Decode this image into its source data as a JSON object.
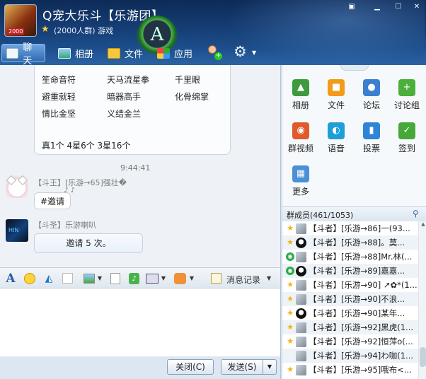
{
  "window": {
    "group_name": "Q宠大乐斗【乐游团】",
    "group_sub": "(2000人群) 游戏",
    "avatar_tag": "2000",
    "logo_glyph": "A"
  },
  "toolbar": {
    "tabs": [
      {
        "label": "聊天",
        "icon": "chat-icon",
        "active": true
      },
      {
        "label": "相册",
        "icon": "album-icon"
      },
      {
        "label": "文件",
        "icon": "folder-icon"
      },
      {
        "label": "应用",
        "icon": "apps-icon"
      }
    ]
  },
  "chat": {
    "skills": [
      [
        "笙命音符",
        "天马流星拳",
        "千里眼"
      ],
      [
        "避重就轻",
        "暗器高手",
        "化骨绵掌"
      ],
      [
        "情比金坚",
        "义结金兰",
        ""
      ]
    ],
    "skill_summary": "真1个 4星6个 3星16个",
    "timestamp": "9:44:41",
    "messages": [
      {
        "sender": "【斗王】[乐游→65]强壮�",
        "text": "#邀请",
        "deco": "♪ ♪"
      },
      {
        "sender": "【斗圣】乐游喇叭",
        "text": "邀请 5 次。"
      }
    ]
  },
  "input_toolbar": {
    "history_label": "消息记录"
  },
  "buttons": {
    "close": "关闭(C)",
    "send": "发送(S)"
  },
  "apps": [
    {
      "label": "相册",
      "icon": "album-app-icon",
      "color": "#3d9a3d",
      "glyph": "▲"
    },
    {
      "label": "文件",
      "icon": "file-app-icon",
      "color": "#f29b1a",
      "glyph": "■"
    },
    {
      "label": "论坛",
      "icon": "forum-app-icon",
      "color": "#3a7fd0",
      "glyph": "●"
    },
    {
      "label": "讨论组",
      "icon": "discussion-app-icon",
      "color": "#4caf3b",
      "glyph": "+"
    },
    {
      "label": "群视频",
      "icon": "video-app-icon",
      "color": "#e05a2a",
      "glyph": "◉"
    },
    {
      "label": "语音",
      "icon": "voice-app-icon",
      "color": "#1f9fd8",
      "glyph": "◐"
    },
    {
      "label": "投票",
      "icon": "vote-app-icon",
      "color": "#2f84d6",
      "glyph": "▮"
    },
    {
      "label": "签到",
      "icon": "checkin-app-icon",
      "color": "#47a83a",
      "glyph": "✓"
    },
    {
      "label": "更多",
      "icon": "more-app-icon",
      "color": "#4b8fd6",
      "glyph": "▦"
    }
  ],
  "members": {
    "title": "群成员(461/1053)",
    "list": [
      {
        "role": "star",
        "ava": "gray",
        "name": "【斗者】[乐游→86]一(93..."
      },
      {
        "role": "star",
        "ava": "penguin",
        "name": "【斗者】[乐游→88]。莫..."
      },
      {
        "role": "green",
        "ava": "gray",
        "name": "【斗者】[乐游→88]Mr.林(..."
      },
      {
        "role": "green",
        "ava": "penguin",
        "name": "【斗者】[乐游→89]嘉嘉..."
      },
      {
        "role": "star",
        "ava": "gray",
        "name": "【斗者】[乐游→90] ↗✿*(1..."
      },
      {
        "role": "star",
        "ava": "gray",
        "name": "【斗者】[乐游→90]不浪..."
      },
      {
        "role": "star",
        "ava": "penguin",
        "name": "【斗者】[乐游→90]某年..."
      },
      {
        "role": "star",
        "ava": "gray",
        "name": "【斗者】[乐游→92]黑虎(1..."
      },
      {
        "role": "star",
        "ava": "gray",
        "name": "【斗者】[乐游→92]恒萍o(..."
      },
      {
        "role": "none",
        "ava": "gray",
        "name": "【斗者】[乐游→94]わ咖(1..."
      },
      {
        "role": "star",
        "ava": "gray",
        "name": "【斗者】[乐游→95]哦布<..."
      }
    ]
  }
}
